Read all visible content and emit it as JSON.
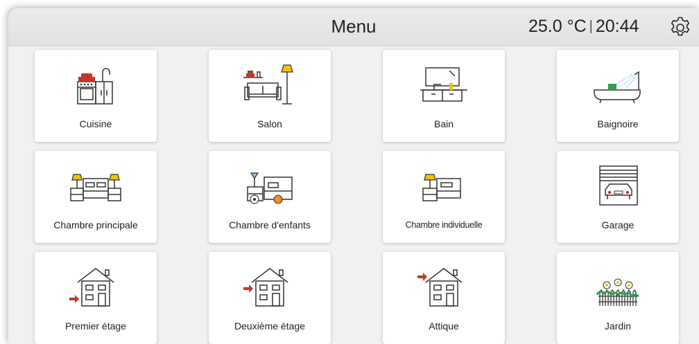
{
  "header": {
    "title": "Menu",
    "temperature": "25.0 °C",
    "separator": "|",
    "time": "20:44",
    "settings_icon": "gear-icon"
  },
  "tiles": [
    {
      "label": "Cuisine",
      "icon": "kitchen-icon"
    },
    {
      "label": "Salon",
      "icon": "living-room-icon"
    },
    {
      "label": "Bain",
      "icon": "bathroom-icon"
    },
    {
      "label": "Baignoire",
      "icon": "bathtub-icon"
    },
    {
      "label": "Chambre principale",
      "icon": "master-bedroom-icon"
    },
    {
      "label": "Chambre d'enfants",
      "icon": "kids-room-icon"
    },
    {
      "label": "Chambre individuelle",
      "icon": "single-bedroom-icon"
    },
    {
      "label": "Garage",
      "icon": "garage-icon"
    },
    {
      "label": "Premier étage",
      "icon": "first-floor-house-icon"
    },
    {
      "label": "Deuxième étage",
      "icon": "second-floor-house-icon"
    },
    {
      "label": "Attique",
      "icon": "attic-house-icon"
    },
    {
      "label": "Jardin",
      "icon": "garden-icon"
    }
  ],
  "colors": {
    "accent_red": "#c0392b",
    "accent_yellow": "#f2c200",
    "accent_green": "#2e9e4f",
    "accent_blue": "#7fc3ea",
    "accent_orange": "#f08a24",
    "line": "#333333"
  }
}
